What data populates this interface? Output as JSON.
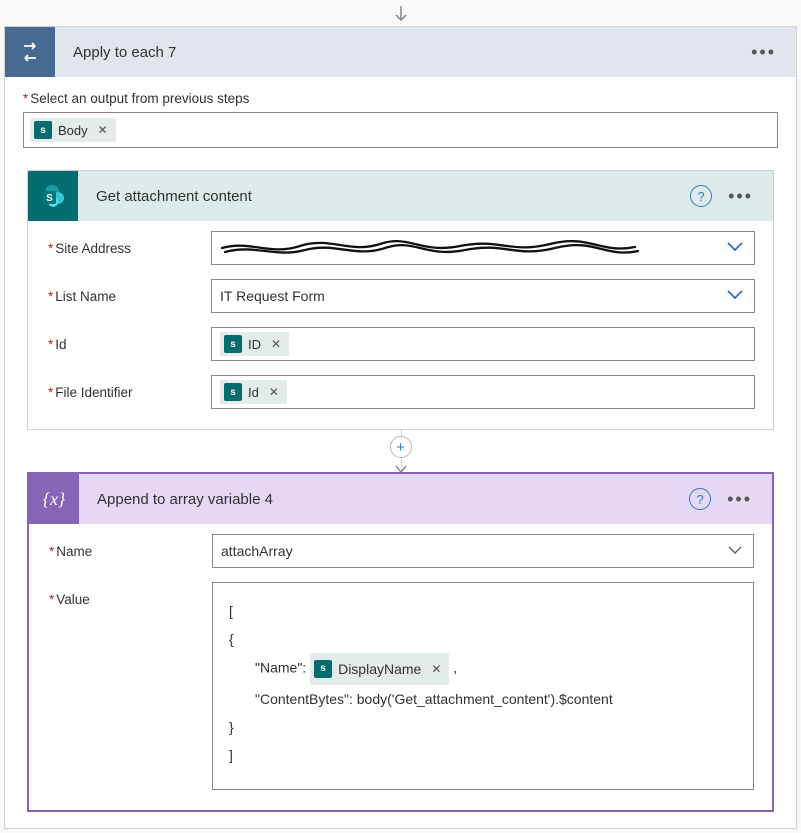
{
  "loop": {
    "title": "Apply to each 7",
    "output_label": "Select an output from previous steps",
    "body_token": "Body"
  },
  "attach": {
    "title": "Get attachment content",
    "fields": {
      "site_label": "Site Address",
      "list_label": "List Name",
      "list_value": "IT Request Form",
      "id_label": "Id",
      "id_token": "ID",
      "file_label": "File Identifier",
      "file_token": "Id"
    }
  },
  "append": {
    "title": "Append to array variable 4",
    "name_label": "Name",
    "name_value": "attachArray",
    "value_label": "Value",
    "value_block": {
      "open1": "[",
      "open2": "{",
      "name_key": "\"Name\":",
      "name_token": "DisplayName",
      "trail_comma": ",",
      "content_line": "\"ContentBytes\": body('Get_attachment_content').$content",
      "close2": "}",
      "close1": "]"
    }
  }
}
